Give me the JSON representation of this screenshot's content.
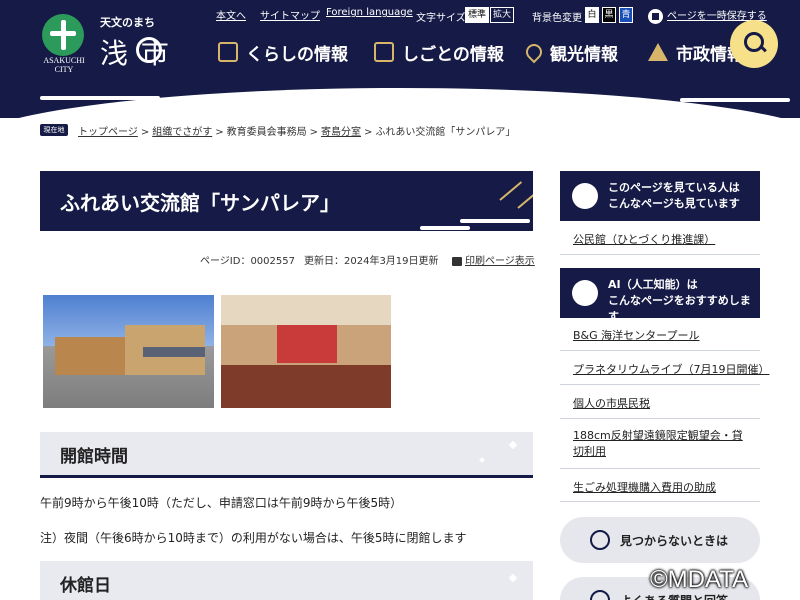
{
  "header": {
    "logo": {
      "tagline": "天文のまち",
      "name": "浅  市",
      "english_line1": "ASAKUCHI",
      "english_line2": "CITY"
    },
    "top_links": [
      "本文へ",
      "サイトマップ",
      "Foreign language"
    ],
    "font_size": {
      "label": "文字サイズ",
      "options": [
        "標準",
        "拡大"
      ]
    },
    "bg_color": {
      "label": "背景色変更",
      "options": [
        "白",
        "黒",
        "青"
      ]
    },
    "save_link": "ページを一時保存する",
    "global_nav": [
      "くらしの情報",
      "しごとの情報",
      "観光情報",
      "市政情報"
    ]
  },
  "breadcrumb": {
    "badge": "現在地",
    "items": [
      "トップページ",
      "組織でさがす",
      "教育委員会事務局",
      "寄島分室",
      "ふれあい交流館「サンパレア」"
    ]
  },
  "page": {
    "title": "ふれあい交流館「サンパレア」",
    "page_id": "ページID：0002557",
    "updated": "更新日：2024年3月19日更新",
    "print": "印刷ページ表示"
  },
  "sections": {
    "hours": {
      "heading": "開館時間",
      "line1": "午前9時から午後10時（ただし、申請窓口は午前9時から午後5時）",
      "line2": "注）夜間（午後6時から10時まで）の利用がない場合は、午後5時に閉館します"
    },
    "closed": {
      "heading": "休館日"
    }
  },
  "sidebar": {
    "viewed_head": [
      "このページを見ている人は",
      "こんなページも見ています"
    ],
    "viewed_links": [
      "公民館（ひとづくり推進課）"
    ],
    "ai_head": [
      "AI（人工知能）は",
      "こんなページをおすすめします"
    ],
    "ai_links": [
      "B&G 海洋センタープール",
      "プラネタリウムライブ（7月19日開催）",
      "個人の市県民税",
      "188cm反射望遠鏡限定観望会・貸切利用",
      "生ごみ処理機購入費用の助成"
    ],
    "not_found_button": "見つからないときは",
    "faq_button": "よくある質問と回答"
  },
  "watermark": "©MDATA",
  "colors": {
    "navy": "#151a46",
    "gold": "#d7b56b",
    "search_yellow": "#f7e08a",
    "logo_green": "#2c9a5a"
  }
}
